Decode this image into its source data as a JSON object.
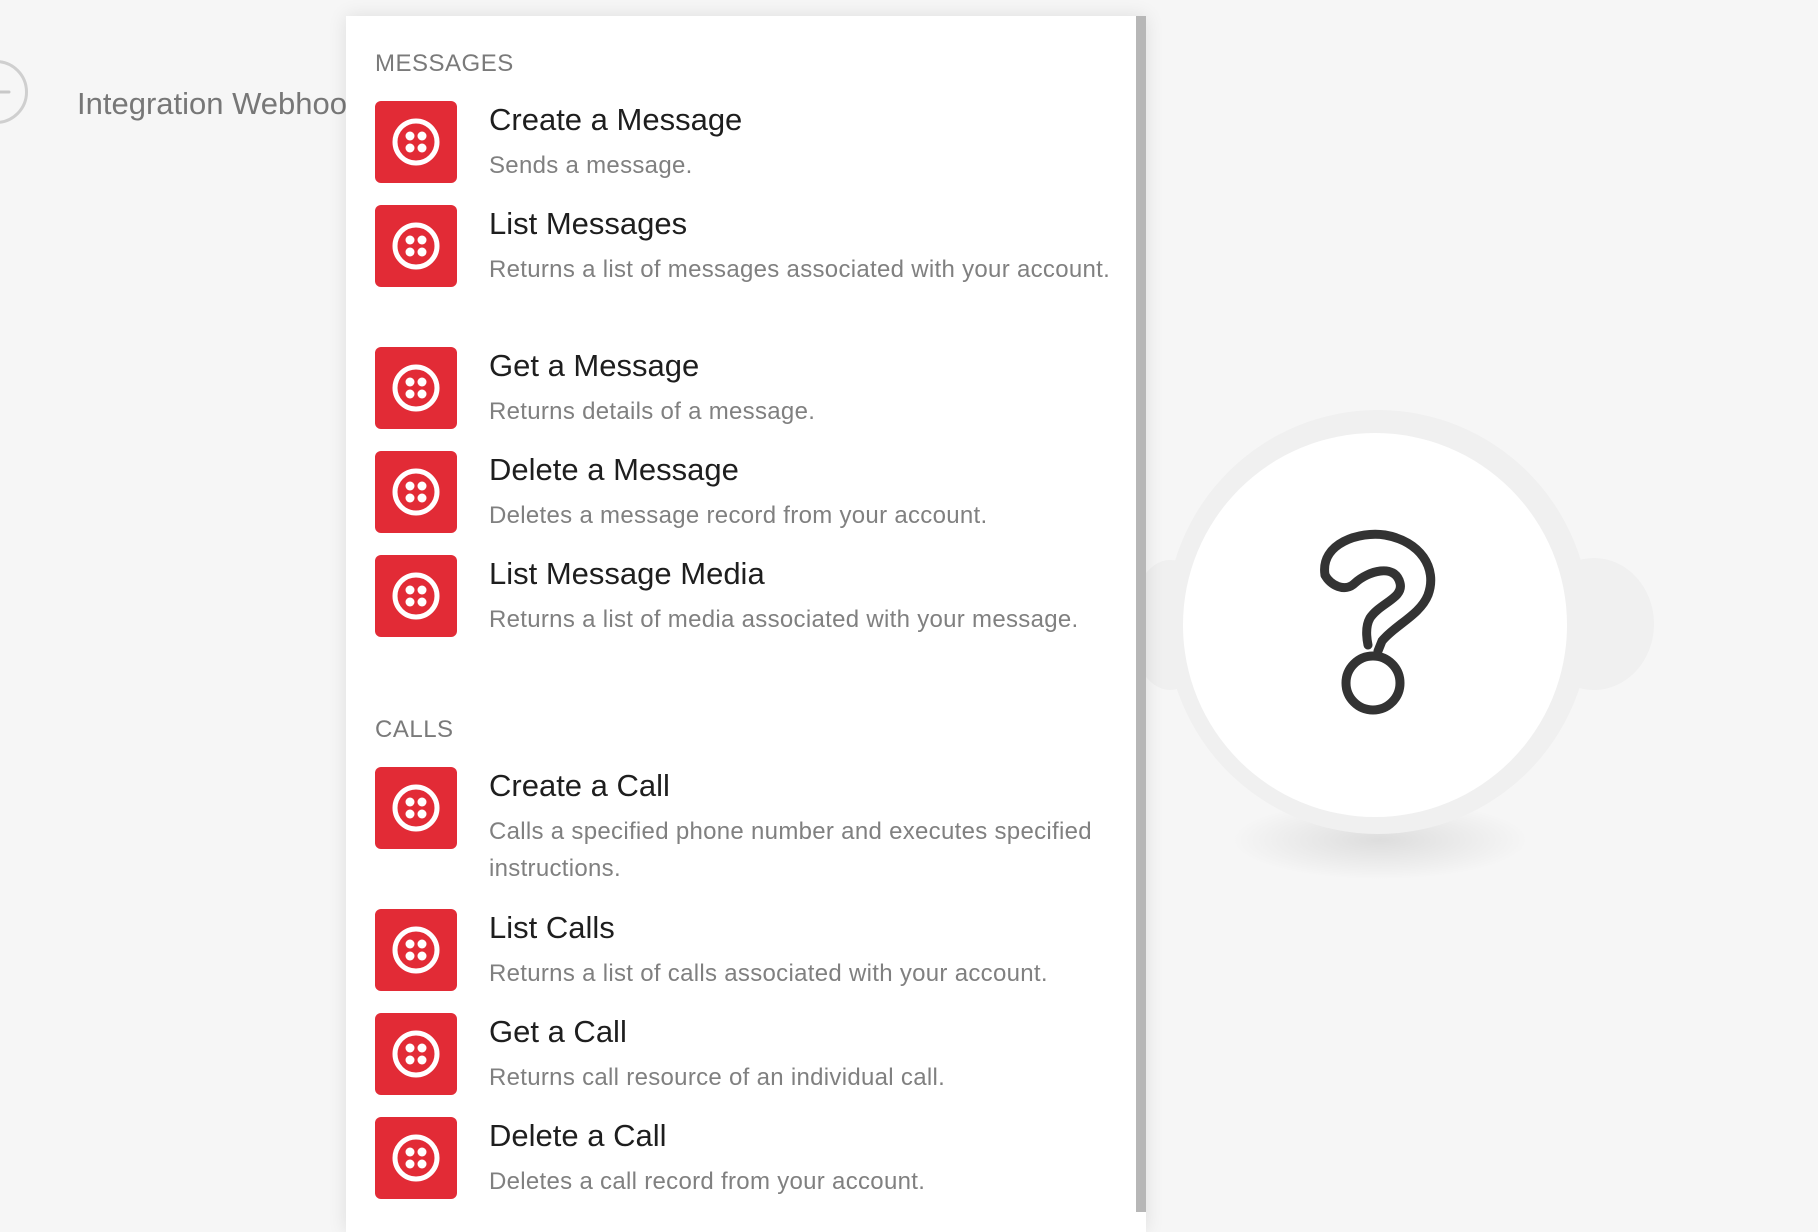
{
  "background_module": {
    "label": "Integration Webhoo",
    "icon": "back-arrow-icon"
  },
  "panel": {
    "sections": [
      {
        "title": "MESSAGES",
        "items": [
          {
            "title": "Create a Message",
            "description": "Sends a message.",
            "icon": "twilio-icon"
          },
          {
            "title": "List Messages",
            "description": "Returns a list of messages associated with your account.",
            "icon": "twilio-icon"
          },
          {
            "title": "Get a Message",
            "description": "Returns details of a message.",
            "icon": "twilio-icon"
          },
          {
            "title": "Delete a Message",
            "description": "Deletes a message record from your account.",
            "icon": "twilio-icon"
          },
          {
            "title": "List Message Media",
            "description": "Returns a list of media associated with your message.",
            "icon": "twilio-icon"
          }
        ]
      },
      {
        "title": "CALLS",
        "items": [
          {
            "title": "Create a Call",
            "description": "Calls a specified phone number and executes specified instructions.",
            "icon": "twilio-icon"
          },
          {
            "title": "List Calls",
            "description": "Returns a list of calls associated with your account.",
            "icon": "twilio-icon"
          },
          {
            "title": "Get a Call",
            "description": "Returns call resource of an individual call.",
            "icon": "twilio-icon"
          },
          {
            "title": "Delete a Call",
            "description": "Deletes a call record from your account.",
            "icon": "twilio-icon"
          }
        ]
      }
    ]
  },
  "placeholder_module": {
    "icon": "question-mark-icon"
  },
  "colors": {
    "accent": "#e22b36",
    "background": "#f6f6f6",
    "title_text": "#1e1e1e",
    "description_text": "#808080"
  }
}
